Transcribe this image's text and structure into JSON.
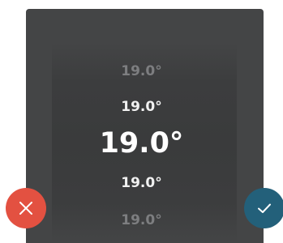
{
  "picker": {
    "values": {
      "above_far": "19.0°",
      "above": "19.0°",
      "selected": "19.0°",
      "below": "19.0°",
      "below_far": "19.0°"
    }
  },
  "actions": {
    "cancel_icon": "close-icon",
    "confirm_icon": "check-icon"
  },
  "colors": {
    "panel": "#444546",
    "cancel": "#e35141",
    "confirm": "#23607a",
    "text_active": "#ffffff",
    "text_dim": "#7d7e80"
  }
}
